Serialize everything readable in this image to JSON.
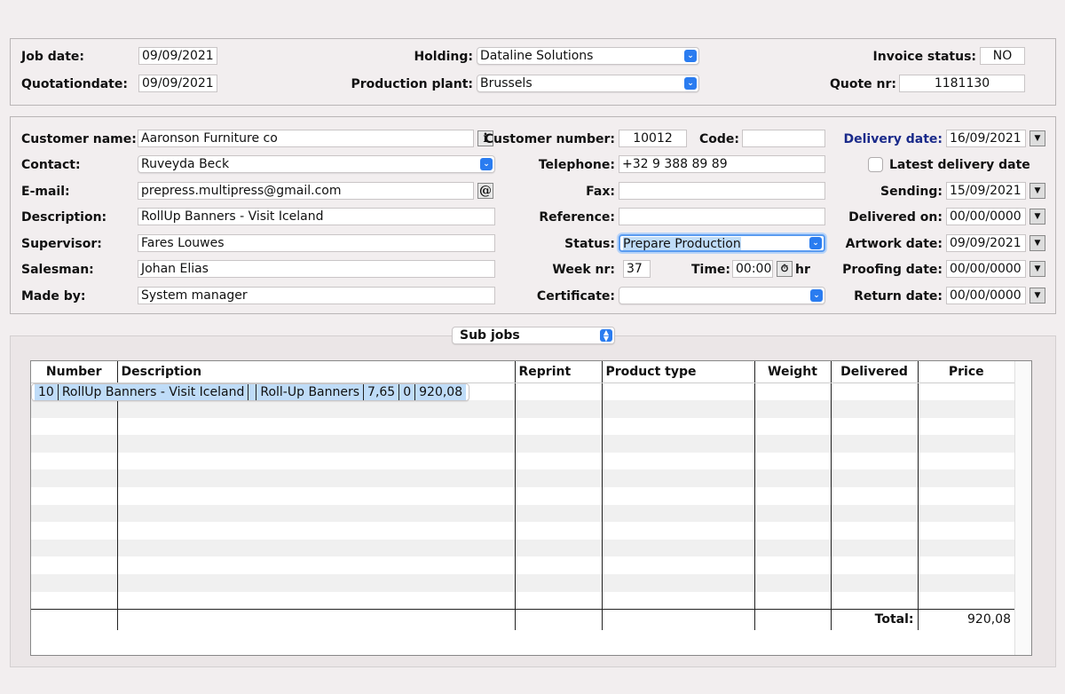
{
  "header": {
    "job_date_label": "Job date:",
    "job_date": "09/09/2021",
    "quotation_date_label": "Quotationdate:",
    "quotation_date": "09/09/2021",
    "holding_label": "Holding:",
    "holding": "Dataline Solutions",
    "production_plant_label": "Production plant:",
    "production_plant": "Brussels",
    "invoice_status_label": "Invoice status:",
    "invoice_status": "NO",
    "quote_nr_label": "Quote nr:",
    "quote_nr": "1181130"
  },
  "customer": {
    "customer_name_label": "Customer name:",
    "customer_name": "Aaronson Furniture co",
    "contact_label": "Contact:",
    "contact": "Ruveyda Beck",
    "email_label": "E-mail:",
    "email": "prepress.multipress@gmail.com",
    "description_label": "Description:",
    "description": "RollUp Banners - Visit Iceland",
    "supervisor_label": "Supervisor:",
    "supervisor": "Fares Louwes",
    "salesman_label": "Salesman:",
    "salesman": "Johan Elias",
    "made_by_label": "Made by:",
    "made_by": "System manager",
    "customer_number_label": "Customer number:",
    "customer_number": "10012",
    "code_label": "Code:",
    "code": "",
    "telephone_label": "Telephone:",
    "telephone": "+32 9 388 89 89",
    "fax_label": "Fax:",
    "fax": "",
    "reference_label": "Reference:",
    "reference": "",
    "status_label": "Status:",
    "status": "Prepare Production",
    "week_nr_label": "Week nr:",
    "week_nr": "37",
    "time_label": "Time:",
    "time": "00:00",
    "hr_label": "hr",
    "certificate_label": "Certificate:",
    "certificate": "",
    "info_button": "i",
    "email_button": "@"
  },
  "dates": {
    "delivery_date_label": "Delivery date:",
    "delivery_date": "16/09/2021",
    "latest_delivery_label": "Latest delivery date",
    "sending_label": "Sending:",
    "sending": "15/09/2021",
    "delivered_on_label": "Delivered on:",
    "delivered_on": "00/00/0000",
    "artwork_date_label": "Artwork date:",
    "artwork_date": "09/09/2021",
    "proofing_date_label": "Proofing date:",
    "proofing_date": "00/00/0000",
    "return_date_label": "Return date:",
    "return_date": "00/00/0000"
  },
  "subjobs": {
    "selector": "Sub jobs",
    "columns": [
      "Number",
      "Description",
      "Reprint",
      "Product type",
      "Weight",
      "Delivered",
      "Price"
    ],
    "rows": [
      {
        "number": "10",
        "description": "RollUp Banners - Visit Iceland",
        "reprint": "",
        "product_type": "Roll-Up Banners",
        "weight": "7,65",
        "delivered": "0",
        "price": "920,08"
      }
    ],
    "total_label": "Total:",
    "total": "920,08"
  },
  "colors": {
    "background": "#f2eeef",
    "accent": "#2a7cf0",
    "selected_row": "#bfdcf8",
    "delivery_label": "#1a2a8a"
  }
}
